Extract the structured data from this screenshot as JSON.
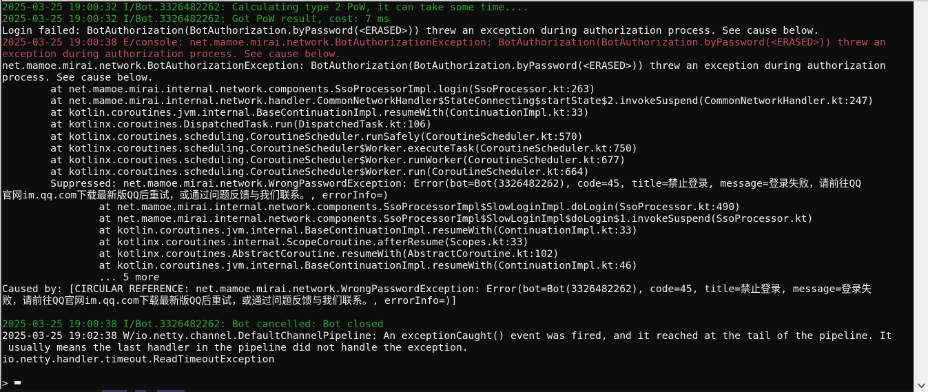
{
  "window": {
    "title": "mirai console",
    "background_color": "#0d0d0d",
    "colors": {
      "green": "#2ba32b",
      "red": "#c04a64",
      "white": "#efefef",
      "scrollbar": "#f0f0f0"
    }
  },
  "console": {
    "lines": [
      {
        "color": "green",
        "text": "2025-03-25 19:00:32 I/Bot.3326482262: Calculating type 2 PoW, it can take some time...."
      },
      {
        "color": "green",
        "text": "2025-03-25 19:00:32 I/Bot.3326482262: Got PoW result, cost: 7 ms"
      },
      {
        "color": "white",
        "text": "Login failed: BotAuthorization(BotAuthorization.byPassword(<ERASED>)) threw an exception during authorization process. See cause below."
      },
      {
        "color": "red",
        "text": "2025-03-25 19:00:38 E/console: net.mamoe.mirai.network.BotAuthorizationException: BotAuthorization(BotAuthorization.byPassword(<ERASED>)) threw an"
      },
      {
        "color": "red",
        "text": "exception during authorization process. See cause below."
      },
      {
        "color": "white",
        "text": "net.mamoe.mirai.network.BotAuthorizationException: BotAuthorization(BotAuthorization.byPassword(<ERASED>)) threw an exception during authorization"
      },
      {
        "color": "white",
        "text": "process. See cause below."
      },
      {
        "color": "white",
        "text": "        at net.mamoe.mirai.internal.network.components.SsoProcessorImpl.login(SsoProcessor.kt:263)"
      },
      {
        "color": "white",
        "text": "        at net.mamoe.mirai.internal.network.handler.CommonNetworkHandler$StateConnecting$startState$2.invokeSuspend(CommonNetworkHandler.kt:247)"
      },
      {
        "color": "white",
        "text": "        at kotlin.coroutines.jvm.internal.BaseContinuationImpl.resumeWith(ContinuationImpl.kt:33)"
      },
      {
        "color": "white",
        "text": "        at kotlinx.coroutines.DispatchedTask.run(DispatchedTask.kt:106)"
      },
      {
        "color": "white",
        "text": "        at kotlinx.coroutines.scheduling.CoroutineScheduler.runSafely(CoroutineScheduler.kt:570)"
      },
      {
        "color": "white",
        "text": "        at kotlinx.coroutines.scheduling.CoroutineScheduler$Worker.executeTask(CoroutineScheduler.kt:750)"
      },
      {
        "color": "white",
        "text": "        at kotlinx.coroutines.scheduling.CoroutineScheduler$Worker.runWorker(CoroutineScheduler.kt:677)"
      },
      {
        "color": "white",
        "text": "        at kotlinx.coroutines.scheduling.CoroutineScheduler$Worker.run(CoroutineScheduler.kt:664)"
      },
      {
        "color": "white",
        "text": "        Suppressed: net.mamoe.mirai.network.WrongPasswordException: Error(bot=Bot(3326482262), code=45, title=禁止登录, message=登录失败，请前往QQ"
      },
      {
        "color": "white",
        "text": "官网im.qq.com下载最新版QQ后重试，或通过问题反馈与我们联系。, errorInfo=)"
      },
      {
        "color": "white",
        "text": "                at net.mamoe.mirai.internal.network.components.SsoProcessorImpl$SlowLoginImpl.doLogin(SsoProcessor.kt:490)"
      },
      {
        "color": "white",
        "text": "                at net.mamoe.mirai.internal.network.components.SsoProcessorImpl$SlowLoginImpl$doLogin$1.invokeSuspend(SsoProcessor.kt)"
      },
      {
        "color": "white",
        "text": "                at kotlin.coroutines.jvm.internal.BaseContinuationImpl.resumeWith(ContinuationImpl.kt:33)"
      },
      {
        "color": "white",
        "text": "                at kotlinx.coroutines.internal.ScopeCoroutine.afterResume(Scopes.kt:33)"
      },
      {
        "color": "white",
        "text": "                at kotlinx.coroutines.AbstractCoroutine.resumeWith(AbstractCoroutine.kt:102)"
      },
      {
        "color": "white",
        "text": "                at kotlin.coroutines.jvm.internal.BaseContinuationImpl.resumeWith(ContinuationImpl.kt:46)"
      },
      {
        "color": "white",
        "text": "                ... 5 more"
      },
      {
        "color": "white",
        "text": "Caused by: [CIRCULAR REFERENCE: net.mamoe.mirai.network.WrongPasswordException: Error(bot=Bot(3326482262), code=45, title=禁止登录, message=登录失"
      },
      {
        "color": "white",
        "text": "败，请前往QQ官网im.qq.com下载最新版QQ后重试，或通过问题反馈与我们联系。, errorInfo=)]"
      },
      {
        "color": "blank",
        "text": " "
      },
      {
        "color": "green",
        "text": "2025-03-25 19:00:38 I/Bot.3326482262: Bot cancelled: Bot closed"
      },
      {
        "color": "white",
        "text": "2025-03-25 19:02:38 W/io.netty.channel.DefaultChannelPipeline: An exceptionCaught() event was fired, and it reached at the tail of the pipeline. It"
      },
      {
        "color": "white",
        "text": " usually means the last handler in the pipeline did not handle the exception."
      },
      {
        "color": "white",
        "text": "io.netty.handler.timeout.ReadTimeoutException"
      },
      {
        "color": "blank",
        "text": " "
      }
    ]
  },
  "prompt": {
    "symbol": ">",
    "value": "",
    "cursor": "block"
  },
  "scrollbar": {
    "arrow_down_icon": "chevron-down-icon",
    "thumb_position": "bottom"
  }
}
